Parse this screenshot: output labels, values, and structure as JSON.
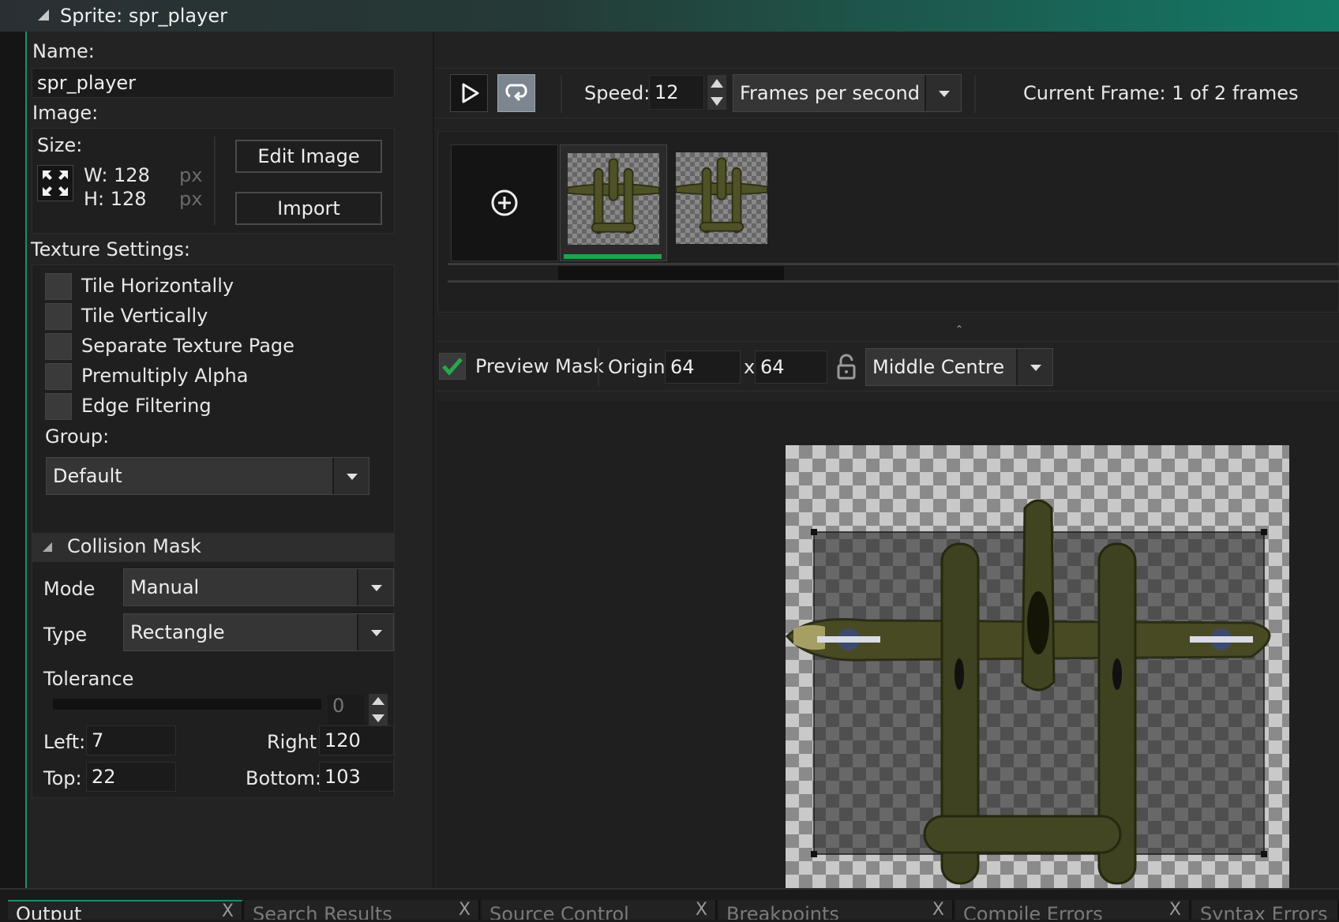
{
  "window": {
    "title": "Sprite: spr_player"
  },
  "left": {
    "name_label": "Name:",
    "name_value": "spr_player",
    "image_label": "Image:",
    "size_label": "Size:",
    "width_label": "W: 128",
    "height_label": "H: 128",
    "px_unit": "px",
    "edit_image": "Edit Image",
    "import": "Import",
    "texture_label": "Texture Settings:",
    "texture_options": [
      {
        "label": "Tile Horizontally",
        "checked": false
      },
      {
        "label": "Tile Vertically",
        "checked": false
      },
      {
        "label": "Separate Texture Page",
        "checked": false
      },
      {
        "label": "Premultiply Alpha",
        "checked": false
      },
      {
        "label": "Edge Filtering",
        "checked": false
      }
    ],
    "group_label": "Group:",
    "group_value": "Default"
  },
  "collision": {
    "title": "Collision Mask",
    "mode_label": "Mode",
    "mode_value": "Manual",
    "type_label": "Type",
    "type_value": "Rectangle",
    "tolerance_label": "Tolerance",
    "tolerance_value": "0",
    "left_label": "Left:",
    "left_value": "7",
    "right_label": "Right:",
    "right_value": "120",
    "top_label": "Top:",
    "top_value": "22",
    "bottom_label": "Bottom:",
    "bottom_value": "103"
  },
  "playback": {
    "speed_label": "Speed:",
    "speed_value": "12",
    "speed_unit": "Frames per second",
    "current_frame": "Current Frame: 1 of 2 frames"
  },
  "frames": {
    "count": 2,
    "selected": 1
  },
  "preview": {
    "mask_label": "Preview Mask",
    "mask_checked": true,
    "origin_label": "Origin:",
    "origin_x": "64",
    "origin_sep": "x",
    "origin_y": "64",
    "origin_preset": "Middle Centre"
  },
  "bottom_tabs": [
    {
      "label": "Output",
      "active": true
    },
    {
      "label": "Search Results",
      "active": false
    },
    {
      "label": "Source Control",
      "active": false
    },
    {
      "label": "Breakpoints",
      "active": false
    },
    {
      "label": "Compile Errors",
      "active": false
    },
    {
      "label": "Syntax Errors",
      "active": false
    }
  ],
  "icons": {
    "close_tab": "X"
  },
  "colors": {
    "accent": "#1f8a6e",
    "selected_frame": "#1fa34a",
    "check": "#27a84f"
  }
}
